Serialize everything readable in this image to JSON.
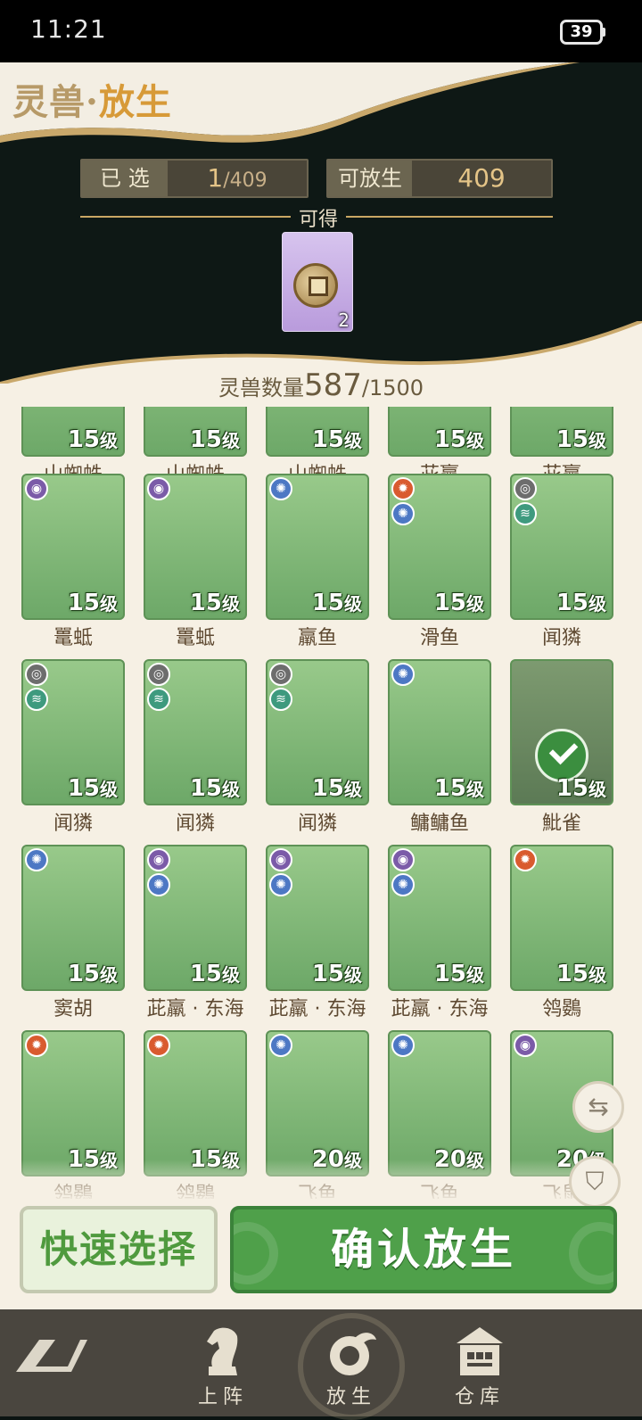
{
  "status_bar": {
    "time": "11:21",
    "battery": "39"
  },
  "header": {
    "title_prefix": "灵兽·",
    "title_main": "放生",
    "selected_label": "已 选",
    "selected_value": "1",
    "selected_total": "/409",
    "releasable_label": "可放生",
    "releasable_value": "409",
    "obtain_label": "可得"
  },
  "reward": {
    "icon": "coin-icon",
    "count": "2",
    "card_color": "#c9b2e8"
  },
  "panel": {
    "count_label": "灵兽数量",
    "count_value": "587",
    "count_max": "/1500"
  },
  "level_suffix": "级",
  "cards": [
    {
      "name": "山蜘蛛",
      "level": "15",
      "badges": []
    },
    {
      "name": "山蜘蛛",
      "level": "15",
      "badges": []
    },
    {
      "name": "山蜘蛛",
      "level": "15",
      "badges": []
    },
    {
      "name": "茈羸",
      "level": "15",
      "badges": []
    },
    {
      "name": "茈羸",
      "level": "15",
      "badges": []
    },
    {
      "name": "鼍蚳",
      "level": "15",
      "badges": [
        "purple"
      ]
    },
    {
      "name": "鼍蚳",
      "level": "15",
      "badges": [
        "purple"
      ]
    },
    {
      "name": "羸鱼",
      "level": "15",
      "badges": [
        "blue"
      ]
    },
    {
      "name": "滑鱼",
      "level": "15",
      "badges": [
        "red",
        "blue"
      ]
    },
    {
      "name": "闻獜",
      "level": "15",
      "badges": [
        "gray",
        "green"
      ]
    },
    {
      "name": "闻獜",
      "level": "15",
      "badges": [
        "gray",
        "green"
      ]
    },
    {
      "name": "闻獜",
      "level": "15",
      "badges": [
        "gray",
        "green"
      ]
    },
    {
      "name": "闻獜",
      "level": "15",
      "badges": [
        "gray",
        "green"
      ]
    },
    {
      "name": "鳙鳙鱼",
      "level": "15",
      "badges": [
        "blue"
      ]
    },
    {
      "name": "魮雀",
      "level": "15",
      "badges": [],
      "selected": true
    },
    {
      "name": "窦胡",
      "level": "15",
      "badges": [
        "blue"
      ]
    },
    {
      "name": "茈羸 · 东海",
      "level": "15",
      "badges": [
        "purple",
        "blue"
      ]
    },
    {
      "name": "茈羸 · 东海",
      "level": "15",
      "badges": [
        "purple",
        "blue"
      ]
    },
    {
      "name": "茈羸 · 东海",
      "level": "15",
      "badges": [
        "purple",
        "blue"
      ]
    },
    {
      "name": "鸰鷃",
      "level": "15",
      "badges": [
        "red"
      ]
    },
    {
      "name": "鸰鷃",
      "level": "15",
      "badges": [
        "red"
      ]
    },
    {
      "name": "鸰鷃",
      "level": "15",
      "badges": [
        "red"
      ]
    },
    {
      "name": "飞鱼",
      "level": "20",
      "badges": [
        "blue"
      ]
    },
    {
      "name": "飞鱼",
      "level": "20",
      "badges": [
        "blue"
      ]
    },
    {
      "name": "飞鼠",
      "level": "20",
      "badges": [
        "purple"
      ]
    }
  ],
  "side_buttons": {
    "swap_icon": "⇆",
    "filter_icon": "⛉"
  },
  "buttons": {
    "quick_select": "快速选择",
    "confirm_release": "确认放生"
  },
  "nav": {
    "deploy": "上阵",
    "release": "放生",
    "storage": "仓库"
  },
  "colors": {
    "accent_green": "#4fa04a",
    "card_green": "#8cc281",
    "title_gold": "#d79a38"
  }
}
